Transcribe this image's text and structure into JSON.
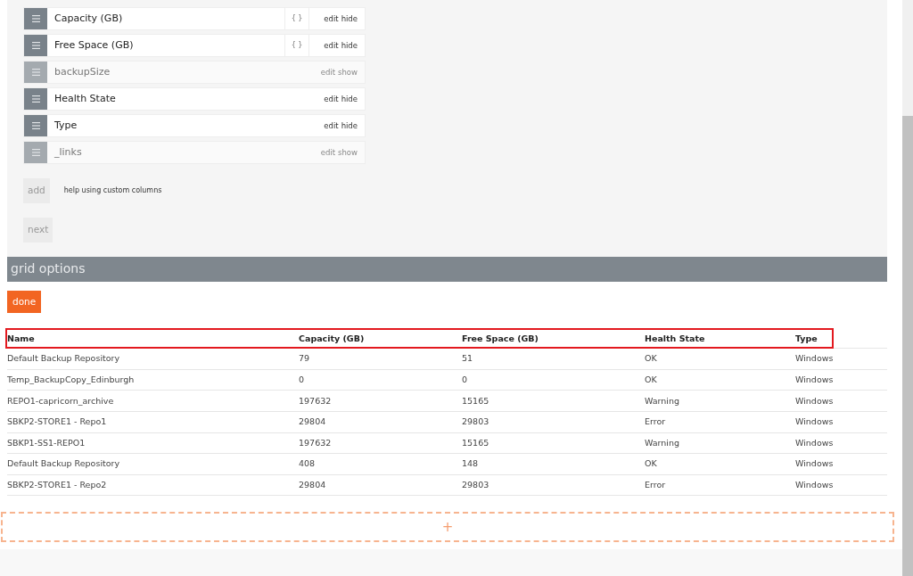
{
  "columns_editor": {
    "columns": [
      {
        "label": "Capacity (GB)",
        "visible": true,
        "template": "{ }",
        "edit": "edit",
        "toggle": "hide"
      },
      {
        "label": "Free Space (GB)",
        "visible": true,
        "template": "{ }",
        "edit": "edit",
        "toggle": "hide"
      },
      {
        "label": "backupSize",
        "visible": false,
        "edit": "edit",
        "toggle": "show"
      },
      {
        "label": "Health State",
        "visible": true,
        "edit": "edit",
        "toggle": "hide"
      },
      {
        "label": "Type",
        "visible": true,
        "edit": "edit",
        "toggle": "hide"
      },
      {
        "label": "_links",
        "visible": false,
        "edit": "edit",
        "toggle": "show"
      }
    ],
    "add_button": "add",
    "help_link": "help using custom columns",
    "next_button": "next"
  },
  "grid_options": {
    "title": "grid options",
    "done_button": "done"
  },
  "table": {
    "header_highlighted": true,
    "columns": [
      "Name",
      "Capacity (GB)",
      "Free Space (GB)",
      "Health State",
      "Type"
    ],
    "rows": [
      [
        "Default Backup Repository",
        "79",
        "51",
        "OK",
        "Windows"
      ],
      [
        "Temp_BackupCopy_Edinburgh",
        "0",
        "0",
        "OK",
        "Windows"
      ],
      [
        "REPO1-capricorn_archive",
        "197632",
        "15165",
        "Warning",
        "Windows"
      ],
      [
        "SBKP2-STORE1 - Repo1",
        "29804",
        "29803",
        "Error",
        "Windows"
      ],
      [
        "SBKP1-SS1-REPO1",
        "197632",
        "15165",
        "Warning",
        "Windows"
      ],
      [
        "Default Backup Repository",
        "408",
        "148",
        "OK",
        "Windows"
      ],
      [
        "SBKP2-STORE1 - Repo2",
        "29804",
        "29803",
        "Error",
        "Windows"
      ]
    ]
  },
  "add_widget": {
    "label": "+"
  }
}
